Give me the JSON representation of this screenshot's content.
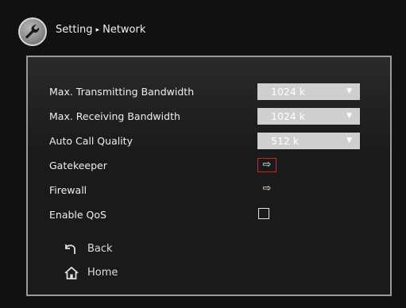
{
  "header": {
    "breadcrumb_parent": "Setting",
    "breadcrumb_separator": "▸",
    "breadcrumb_current": "Network",
    "logo_icon": "wrench-icon"
  },
  "settings": [
    {
      "label": "Max. Transmitting Bandwidth",
      "control": "dropdown",
      "value": "1024 k"
    },
    {
      "label": "Max. Receiving Bandwidth",
      "control": "dropdown",
      "value": "1024 k"
    },
    {
      "label": "Auto Call Quality",
      "control": "dropdown",
      "value": "512 k"
    },
    {
      "label": "Gatekeeper",
      "control": "arrow",
      "icon": "⇨",
      "selected": true
    },
    {
      "label": "Firewall",
      "control": "arrow",
      "icon": "⇨",
      "selected": false
    },
    {
      "label": "Enable QoS",
      "control": "checkbox",
      "checked": false
    }
  ],
  "nav": {
    "back_label": "Back",
    "home_label": "Home"
  },
  "colors": {
    "selection_border": "#cc2222",
    "dropdown_bg": "#cfcfcf",
    "panel_border": "#9a9a9a"
  }
}
